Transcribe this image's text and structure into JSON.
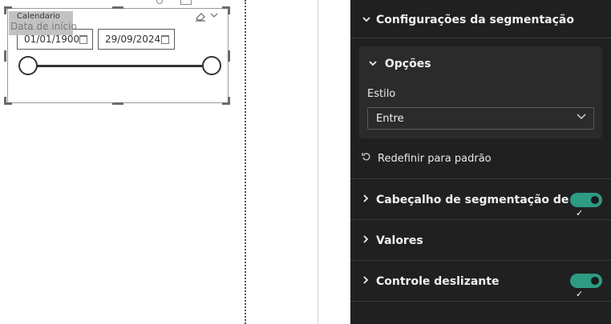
{
  "slicer": {
    "title": "Calendario",
    "tooltip": "Data de início",
    "start_date": "01/01/1900",
    "end_date": "29/09/2024",
    "icons": [
      "eraser-icon",
      "chevron-down-icon",
      "calendar-icon"
    ]
  },
  "format_pane": {
    "sections": {
      "config": "Configurações da segmentação",
      "options": "Opções",
      "style_label": "Estilo",
      "style_value": "Entre",
      "reset": "Redefinir para padrão",
      "header": "Cabeçalho de segmentação de ...",
      "values": "Valores",
      "slider_control": "Controle deslizante"
    },
    "toggles": {
      "header_on": true,
      "slider_on": true
    },
    "colors": {
      "pane_bg": "#202020",
      "toggle_on": "#2e9b82"
    }
  }
}
